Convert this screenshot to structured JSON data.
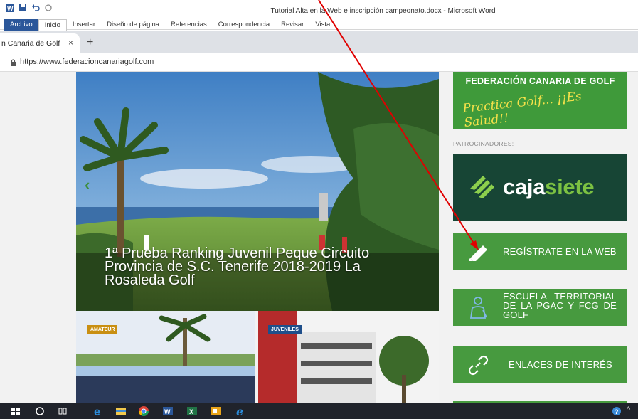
{
  "word": {
    "title": "Tutorial Alta en la Web e inscripción campeonato.docx  -  Microsoft Word",
    "tabs": [
      "Archivo",
      "Inicio",
      "Insertar",
      "Diseño de página",
      "Referencias",
      "Correspondencia",
      "Revisar",
      "Vista"
    ]
  },
  "browser": {
    "tab_title": "n Canaria de Golf",
    "tab_close": "×",
    "new_tab": "+",
    "url": "https://www.federacioncanariagolf.com"
  },
  "hero": {
    "caption": "1ª Prueba Ranking Juvenil Peque Circuito Provincia de S.C. Tenerife 2018-2019 La Rosaleda Golf",
    "prev": "‹"
  },
  "thumbs": [
    {
      "badge": "AMATEUR"
    },
    {
      "badge": "JUVENILES"
    }
  ],
  "sidebar": {
    "fcg_title": "FEDERACIÓN CANARIA DE GOLF",
    "fcg_slogan": "Practica Golf... ¡¡Es Salud!!",
    "sponsors_label": "PATROCINADORES:",
    "sponsor": {
      "text_1": "caja",
      "text_2": "siete"
    },
    "buttons": [
      {
        "label": "REGÍSTRATE EN LA WEB",
        "icon": "pencil-icon"
      },
      {
        "label": "ESCUELA TERRITORIAL DE LA PGAC Y FCG DE GOLF",
        "icon": "golfer-icon"
      },
      {
        "label": "ENLACES DE INTERÉS",
        "icon": "link-icon"
      }
    ]
  },
  "colors": {
    "accent_green": "#479a3f",
    "sponsor_green": "#174535",
    "annotation_red": "#e00000",
    "word_blue": "#2b579a"
  }
}
